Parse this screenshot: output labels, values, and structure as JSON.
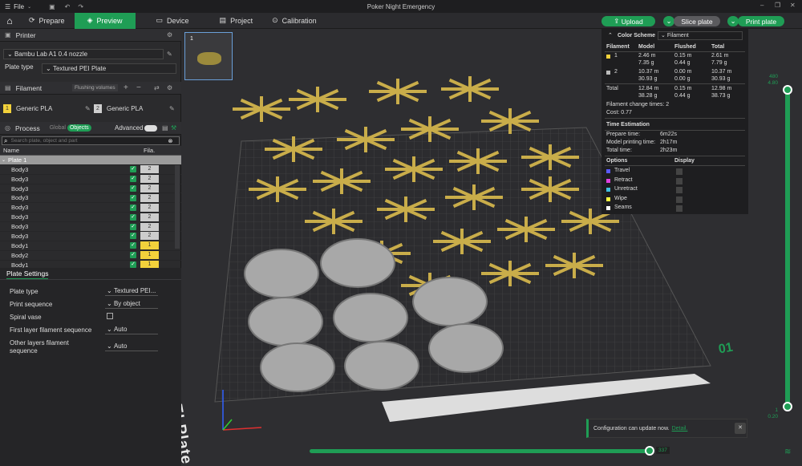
{
  "titlebar": {
    "menu": "File",
    "title": "Poker Night Emergency"
  },
  "nav": {
    "tabs": [
      "Prepare",
      "Preview",
      "Device",
      "Project",
      "Calibration"
    ],
    "upload": "Upload",
    "slice": "Slice plate",
    "print": "Print plate"
  },
  "printer": {
    "heading": "Printer",
    "model": "Bambu Lab A1 0.4 nozzle",
    "plate_label": "Plate type",
    "plate_value": "Textured PEI Plate"
  },
  "filament": {
    "heading": "Filament",
    "flushing": "Flushing volumes",
    "slots": [
      {
        "num": "1",
        "name": "Generic PLA",
        "color": "#f2d13b"
      },
      {
        "num": "2",
        "name": "Generic PLA",
        "color": "#cfcfcf"
      }
    ]
  },
  "process": {
    "heading": "Process",
    "global": "Global",
    "objects": "Objects",
    "advanced": "Advanced",
    "search_placeholder": "Search plate, object and part"
  },
  "objlist": {
    "col_name": "Name",
    "col_fila": "Fila.",
    "plate": "Plate 1",
    "rows": [
      {
        "n": "Body3",
        "f": "2"
      },
      {
        "n": "Body3",
        "f": "2"
      },
      {
        "n": "Body3",
        "f": "2"
      },
      {
        "n": "Body3",
        "f": "2"
      },
      {
        "n": "Body3",
        "f": "2"
      },
      {
        "n": "Body3",
        "f": "2"
      },
      {
        "n": "Body3",
        "f": "2"
      },
      {
        "n": "Body3",
        "f": "2"
      },
      {
        "n": "Body1",
        "f": "1"
      },
      {
        "n": "Body2",
        "f": "1"
      },
      {
        "n": "Body1",
        "f": "1"
      }
    ]
  },
  "plate_settings": {
    "heading": "Plate Settings",
    "items": [
      {
        "label": "Plate type",
        "value": "Textured PEI..."
      },
      {
        "label": "Print sequence",
        "value": "By object"
      },
      {
        "label": "Spiral vase",
        "value": ""
      },
      {
        "label": "First layer filament sequence",
        "value": "Auto"
      },
      {
        "label": "Other layers filament",
        "label2": "sequence",
        "value": "Auto"
      }
    ]
  },
  "legend": {
    "scheme": "Color Scheme",
    "scheme_value": "Filament",
    "cols": [
      "Filament",
      "Model",
      "Flushed",
      "Total"
    ],
    "rows": [
      {
        "id": "1",
        "color": "#f2d13b",
        "model": [
          "2.46 m",
          "7.35 g"
        ],
        "flushed": [
          "0.15 m",
          "0.44 g"
        ],
        "total": [
          "2.61 m",
          "7.79 g"
        ]
      },
      {
        "id": "2",
        "color": "#bbbbbb",
        "model": [
          "10.37 m",
          "30.93 g"
        ],
        "flushed": [
          "0.00 m",
          "0.00 g"
        ],
        "total": [
          "10.37 m",
          "30.93 g"
        ]
      }
    ],
    "total": {
      "label": "Total",
      "model": [
        "12.84 m",
        "38.28 g"
      ],
      "flushed": [
        "0.15 m",
        "0.44 g"
      ],
      "total": [
        "12.98 m",
        "38.73 g"
      ]
    },
    "change_times": "Filament change times:  2",
    "cost": "Cost:  0.77",
    "time_heading": "Time Estimation",
    "prepare_l": "Prepare time:",
    "prepare_v": "6m22s",
    "model_l": "Model printing time:",
    "model_v": "2h17m",
    "total_l": "Total time:",
    "total_v": "2h23m",
    "options": "Options",
    "display": "Display",
    "opts": [
      {
        "n": "Travel",
        "c": "#5a5aff"
      },
      {
        "n": "Retract",
        "c": "#e040e0"
      },
      {
        "n": "Unretract",
        "c": "#40c0e0"
      },
      {
        "n": "Wipe",
        "c": "#ffff40"
      },
      {
        "n": "Seams",
        "c": "#ffffff"
      }
    ]
  },
  "slider": {
    "top": "480",
    "top2": "4.80",
    "bottom": "1",
    "bottom2": "0.20"
  },
  "thumb": {
    "num": "1"
  },
  "bed_text": "Bambu Textured PEI Plate",
  "plate_num": "01",
  "toast": {
    "msg": "Configuration can update now.",
    "link": "Detail."
  },
  "hslider": {
    "value": "337"
  }
}
